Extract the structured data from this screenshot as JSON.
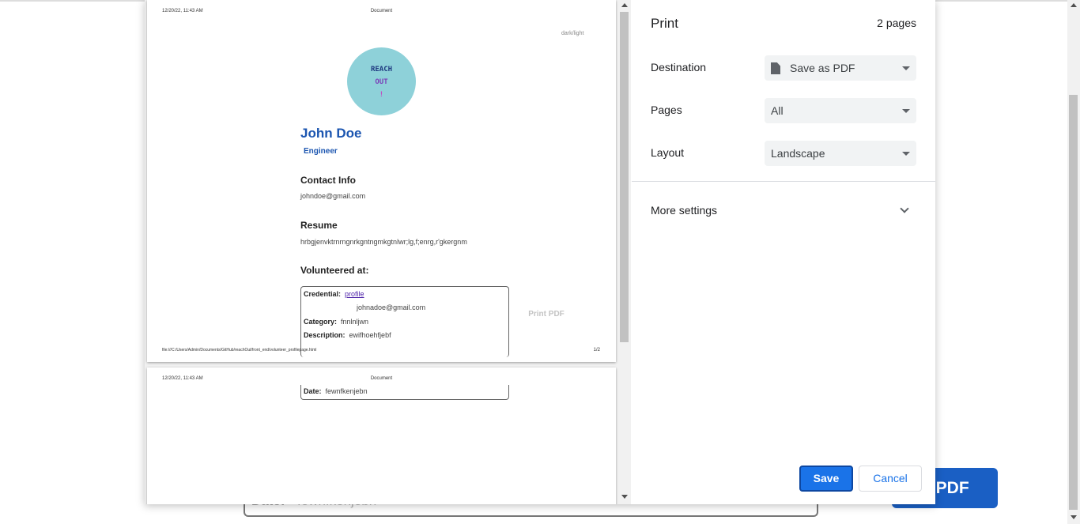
{
  "background": {
    "date_label": "Date:",
    "date_value": "fewnfkenjebn",
    "print_button": "nt PDF"
  },
  "preview": {
    "page1": {
      "header_date": "12/20/22, 11:43 AM",
      "header_title": "Document",
      "dark_light": "dark/light",
      "logo_lines": [
        "REACH",
        "OUT",
        "!"
      ],
      "name": "John Doe",
      "role": "Engineer",
      "contact_heading": "Contact Info",
      "contact_email": "johndoe@gmail.com",
      "resume_heading": "Resume",
      "resume_text": "hrbgjenvktrnrngnrkgntngmkgtnlwr;lg,f;enrg,r'gkergnm",
      "volunteered_heading": "Volunteered at:",
      "credential_label": "Credential:",
      "credential_link": "profile",
      "credential_email": "johnadoe@gmail.com",
      "category_label": "Category:",
      "category_value": "fnnlnljwn",
      "description_label": "Description:",
      "description_value": "ewifhoehfjebf",
      "print_pdf": "Print PDF",
      "footer_url": "file:///C:/Users/Admin/Documents/GitHub/reachOut/front_end/volunteer_profilepage.html",
      "footer_page": "1/2"
    },
    "page2": {
      "header_date": "12/20/22, 11:43 AM",
      "header_title": "Document",
      "date_label": "Date:",
      "date_value": "fewnfkenjebn"
    }
  },
  "settings": {
    "title": "Print",
    "page_count": "2 pages",
    "destination_label": "Destination",
    "destination_value": "Save as PDF",
    "pages_label": "Pages",
    "pages_value": "All",
    "layout_label": "Layout",
    "layout_value": "Landscape",
    "more_settings": "More settings",
    "save_button": "Save",
    "cancel_button": "Cancel"
  }
}
